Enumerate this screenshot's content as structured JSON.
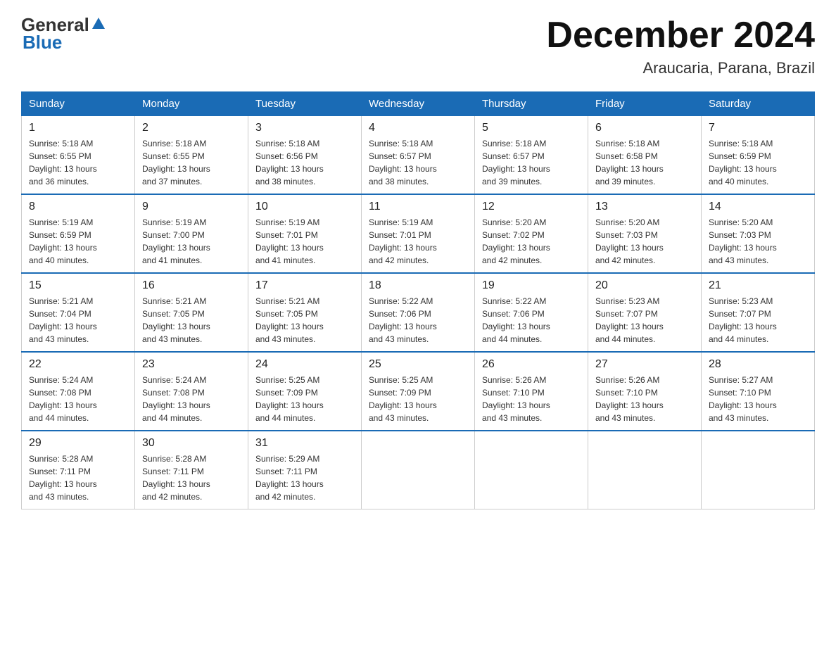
{
  "logo": {
    "general": "General",
    "blue": "Blue"
  },
  "title": {
    "month_year": "December 2024",
    "location": "Araucaria, Parana, Brazil"
  },
  "headers": [
    "Sunday",
    "Monday",
    "Tuesday",
    "Wednesday",
    "Thursday",
    "Friday",
    "Saturday"
  ],
  "weeks": [
    [
      {
        "day": "1",
        "sunrise": "5:18 AM",
        "sunset": "6:55 PM",
        "daylight": "13 hours and 36 minutes."
      },
      {
        "day": "2",
        "sunrise": "5:18 AM",
        "sunset": "6:55 PM",
        "daylight": "13 hours and 37 minutes."
      },
      {
        "day": "3",
        "sunrise": "5:18 AM",
        "sunset": "6:56 PM",
        "daylight": "13 hours and 38 minutes."
      },
      {
        "day": "4",
        "sunrise": "5:18 AM",
        "sunset": "6:57 PM",
        "daylight": "13 hours and 38 minutes."
      },
      {
        "day": "5",
        "sunrise": "5:18 AM",
        "sunset": "6:57 PM",
        "daylight": "13 hours and 39 minutes."
      },
      {
        "day": "6",
        "sunrise": "5:18 AM",
        "sunset": "6:58 PM",
        "daylight": "13 hours and 39 minutes."
      },
      {
        "day": "7",
        "sunrise": "5:18 AM",
        "sunset": "6:59 PM",
        "daylight": "13 hours and 40 minutes."
      }
    ],
    [
      {
        "day": "8",
        "sunrise": "5:19 AM",
        "sunset": "6:59 PM",
        "daylight": "13 hours and 40 minutes."
      },
      {
        "day": "9",
        "sunrise": "5:19 AM",
        "sunset": "7:00 PM",
        "daylight": "13 hours and 41 minutes."
      },
      {
        "day": "10",
        "sunrise": "5:19 AM",
        "sunset": "7:01 PM",
        "daylight": "13 hours and 41 minutes."
      },
      {
        "day": "11",
        "sunrise": "5:19 AM",
        "sunset": "7:01 PM",
        "daylight": "13 hours and 42 minutes."
      },
      {
        "day": "12",
        "sunrise": "5:20 AM",
        "sunset": "7:02 PM",
        "daylight": "13 hours and 42 minutes."
      },
      {
        "day": "13",
        "sunrise": "5:20 AM",
        "sunset": "7:03 PM",
        "daylight": "13 hours and 42 minutes."
      },
      {
        "day": "14",
        "sunrise": "5:20 AM",
        "sunset": "7:03 PM",
        "daylight": "13 hours and 43 minutes."
      }
    ],
    [
      {
        "day": "15",
        "sunrise": "5:21 AM",
        "sunset": "7:04 PM",
        "daylight": "13 hours and 43 minutes."
      },
      {
        "day": "16",
        "sunrise": "5:21 AM",
        "sunset": "7:05 PM",
        "daylight": "13 hours and 43 minutes."
      },
      {
        "day": "17",
        "sunrise": "5:21 AM",
        "sunset": "7:05 PM",
        "daylight": "13 hours and 43 minutes."
      },
      {
        "day": "18",
        "sunrise": "5:22 AM",
        "sunset": "7:06 PM",
        "daylight": "13 hours and 43 minutes."
      },
      {
        "day": "19",
        "sunrise": "5:22 AM",
        "sunset": "7:06 PM",
        "daylight": "13 hours and 44 minutes."
      },
      {
        "day": "20",
        "sunrise": "5:23 AM",
        "sunset": "7:07 PM",
        "daylight": "13 hours and 44 minutes."
      },
      {
        "day": "21",
        "sunrise": "5:23 AM",
        "sunset": "7:07 PM",
        "daylight": "13 hours and 44 minutes."
      }
    ],
    [
      {
        "day": "22",
        "sunrise": "5:24 AM",
        "sunset": "7:08 PM",
        "daylight": "13 hours and 44 minutes."
      },
      {
        "day": "23",
        "sunrise": "5:24 AM",
        "sunset": "7:08 PM",
        "daylight": "13 hours and 44 minutes."
      },
      {
        "day": "24",
        "sunrise": "5:25 AM",
        "sunset": "7:09 PM",
        "daylight": "13 hours and 44 minutes."
      },
      {
        "day": "25",
        "sunrise": "5:25 AM",
        "sunset": "7:09 PM",
        "daylight": "13 hours and 43 minutes."
      },
      {
        "day": "26",
        "sunrise": "5:26 AM",
        "sunset": "7:10 PM",
        "daylight": "13 hours and 43 minutes."
      },
      {
        "day": "27",
        "sunrise": "5:26 AM",
        "sunset": "7:10 PM",
        "daylight": "13 hours and 43 minutes."
      },
      {
        "day": "28",
        "sunrise": "5:27 AM",
        "sunset": "7:10 PM",
        "daylight": "13 hours and 43 minutes."
      }
    ],
    [
      {
        "day": "29",
        "sunrise": "5:28 AM",
        "sunset": "7:11 PM",
        "daylight": "13 hours and 43 minutes."
      },
      {
        "day": "30",
        "sunrise": "5:28 AM",
        "sunset": "7:11 PM",
        "daylight": "13 hours and 42 minutes."
      },
      {
        "day": "31",
        "sunrise": "5:29 AM",
        "sunset": "7:11 PM",
        "daylight": "13 hours and 42 minutes."
      },
      null,
      null,
      null,
      null
    ]
  ],
  "labels": {
    "sunrise": "Sunrise:",
    "sunset": "Sunset:",
    "daylight": "Daylight:"
  }
}
